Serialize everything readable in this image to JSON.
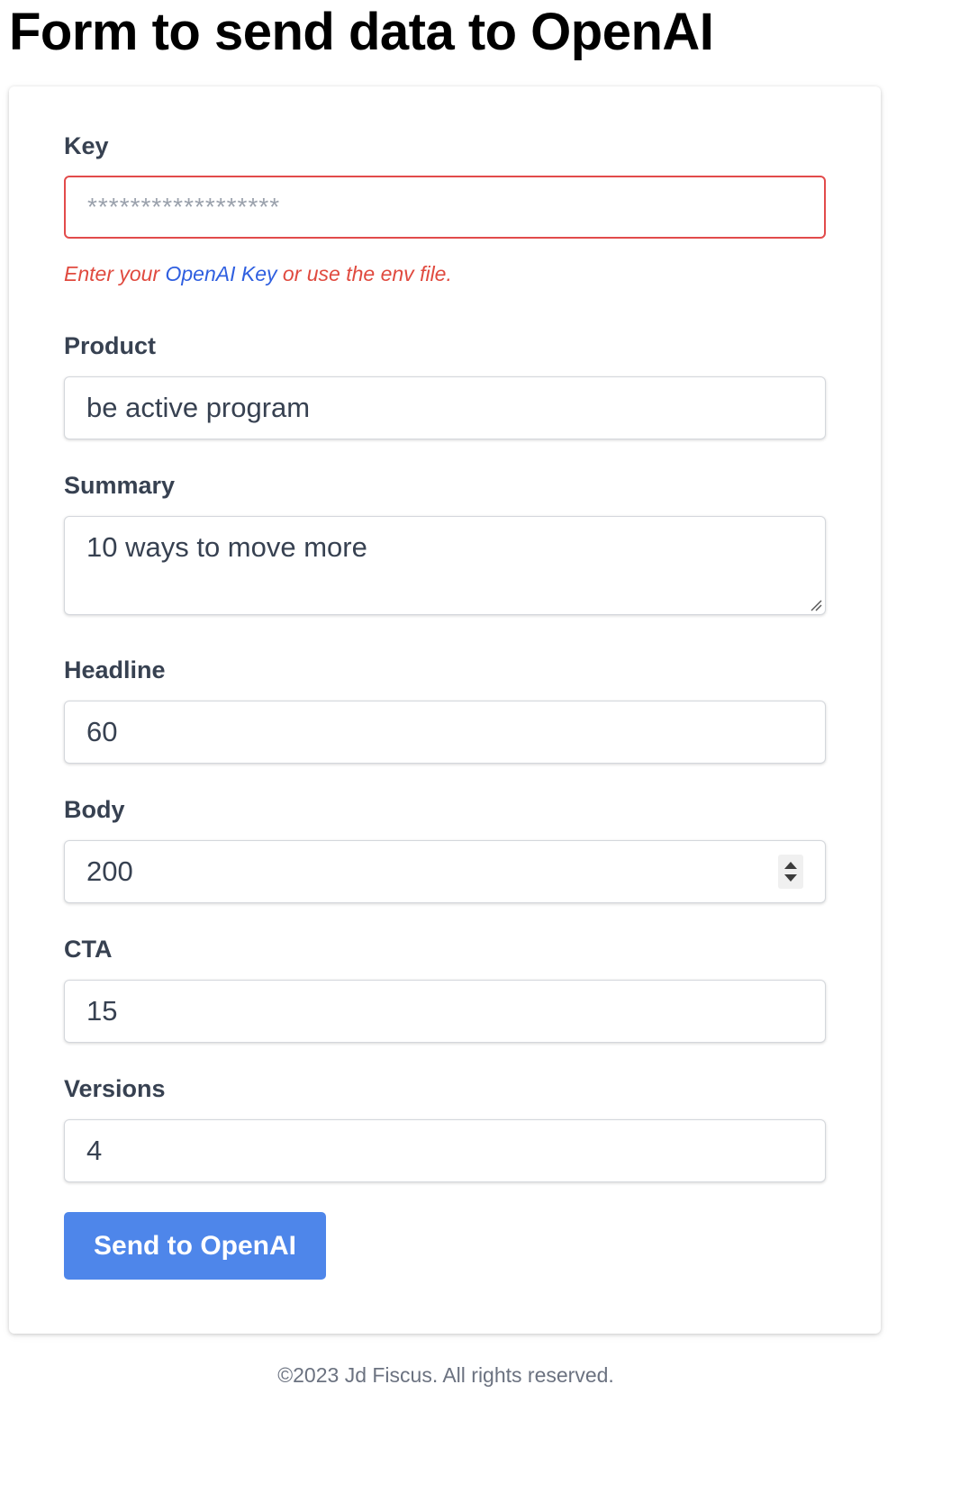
{
  "page": {
    "title": "Form to send data to OpenAI"
  },
  "form": {
    "key": {
      "label": "Key",
      "placeholder": "******************",
      "value": "",
      "help_prefix": "Enter your ",
      "help_link": "OpenAI Key",
      "help_suffix": " or use the env file."
    },
    "product": {
      "label": "Product",
      "value": "be active program"
    },
    "summary": {
      "label": "Summary",
      "value": "10 ways to move more"
    },
    "headline": {
      "label": "Headline",
      "value": "60"
    },
    "body": {
      "label": "Body",
      "value": "200"
    },
    "cta": {
      "label": "CTA",
      "value": "15"
    },
    "versions": {
      "label": "Versions",
      "value": "4"
    },
    "submit_label": "Send to OpenAI"
  },
  "footer": {
    "text": "©2023 Jd Fiscus. All rights reserved."
  },
  "colors": {
    "accent": "#4e86ea",
    "error": "#e04a3f",
    "link": "#2f5fe0"
  }
}
